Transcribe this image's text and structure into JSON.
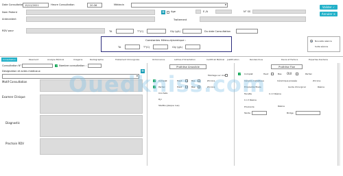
{
  "header": {
    "date_consultation_label": "Date Consultation",
    "date_consultation_value": "15/12/2021",
    "heure_consultation_label": "Heure Consultation",
    "heure_consultation_value": "20:36",
    "medecin_label": "Médecin",
    "valider_label": "Valider",
    "annuler_label": "Annuler"
  },
  "patient": {
    "nom_label": "Nom Patient",
    "age_label": "Age",
    "ea_label": "E /A",
    "ns_label": "N° SS",
    "antecedent_label": "Antecedent",
    "traitement_label": "Traitement",
    "rdv_label": "RDV pour",
    "ta_label": "TA",
    "tc_label": "T°(C)",
    "gly_label": "Gly (g/L)",
    "du_date_label": "Du date Consultation"
  },
  "constantes": {
    "title": "Constantes  Hémo-dynamique :",
    "ta_label": "TA",
    "tc_label": "T°(C)",
    "gly_label": "Gly (g/L)"
  },
  "seance": {
    "nouvelle_label": "Nouvelle séance",
    "suite_label": "Suite séance"
  },
  "tabs": [
    "Consultation",
    "Paiement",
    "Analyse Médical",
    "Imagerie",
    "Radiographie",
    "Traitement Chirurgicale",
    "Ordonnance",
    "Lettres d'Orientation",
    "Certificat Médical",
    "Justification",
    "Rendez-Vous",
    "Devis et Facture",
    "Expertise Dentaire"
  ],
  "consultation": {
    "consultation_no_label": "Consultation N°",
    "nombre_consultation_label": "Nombre consultation :",
    "designation_label": "Designation et actes medicaux",
    "motif_label": "Motif Consultation",
    "examen_label": "Examen Clinique",
    "diagnostic_label": "Diagnostic",
    "prochain_rdv_label": "Prochain RDV"
  },
  "prothese_amovible": {
    "title": "Prothése Amovible",
    "montage_label": "Montage sur cire",
    "complet_label": "Complet",
    "haut_label": "Haut",
    "bas_label": "Bas",
    "partiel_label": "Partiel",
    "crochets_label": "Crochets",
    "pjlt_label": "P.J.I",
    "stellite_label": "Stellite (plaque nue)",
    "zirconne_label": "Zircone"
  },
  "prothese_fixe": {
    "title": "Prothése Fixe",
    "complet_label": "Complet",
    "haut_label": "Haut",
    "bas_label": "Bas",
    "oui_label": "OUI",
    "partiel_label": "Partiel",
    "ceramometal_label": "Céramo-métallique",
    "ceramique_label": "Céramique pressée",
    "zircone_label": "Zircone",
    "empreinte_label": "Empreinte finale",
    "guide_label": "Guide chirurgical",
    "resine_label": "Résine",
    "facette_label": "Facette",
    "civ_label": "C.I.V Résine",
    "civ2_label": "C.I.V Résine",
    "provisoire_label": "Provisoire",
    "resine2_label": "Résine",
    "teinte_label": "Teinte",
    "bridge_label": "Bridge"
  },
  "watermark": "Ouedkniss.com"
}
